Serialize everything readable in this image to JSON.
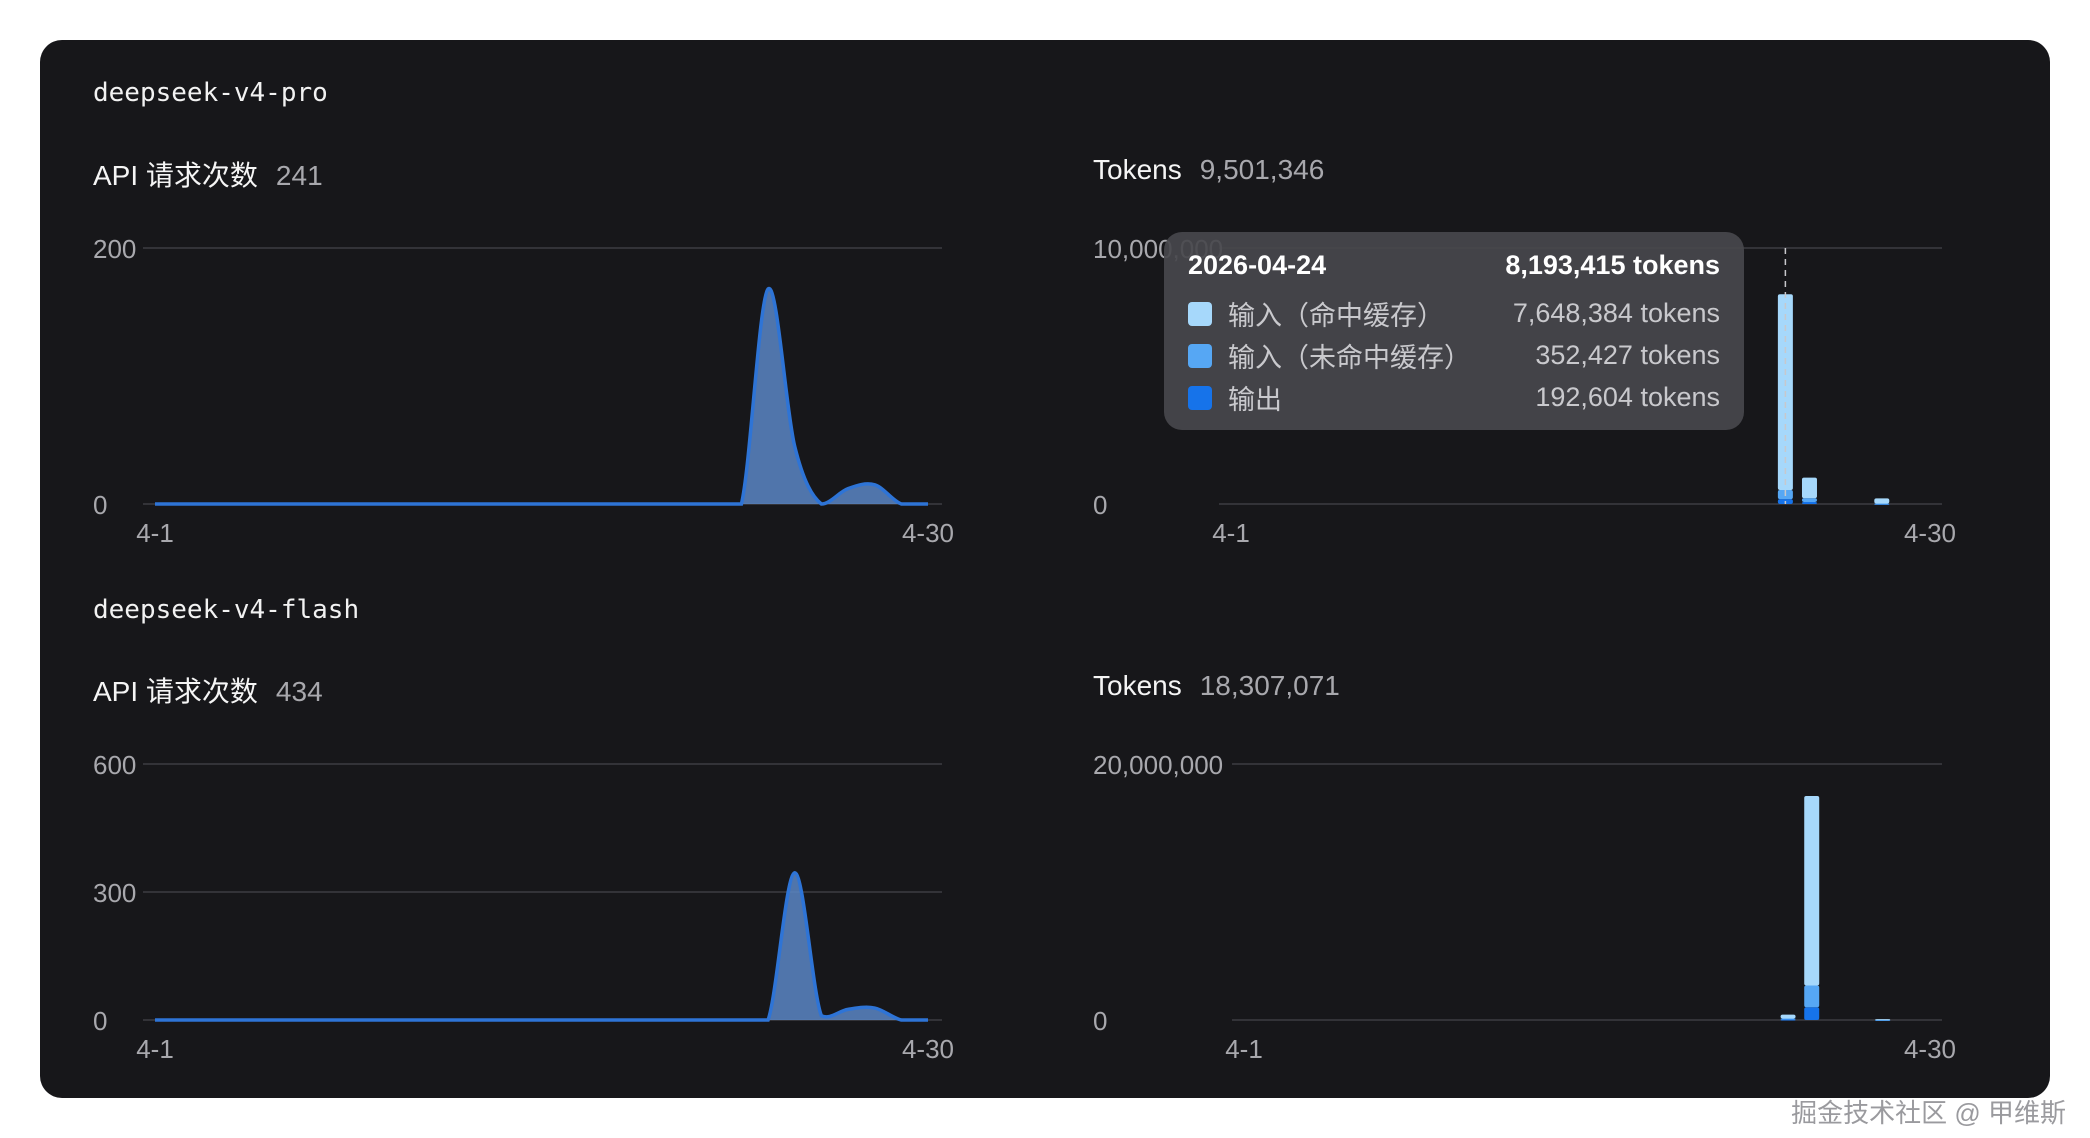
{
  "colors": {
    "area_stroke": "#2e74d6",
    "area_fill": "#5a86c6",
    "cache_hit": "#a6d8fb",
    "cache_miss": "#56a7f4",
    "output": "#1673ea",
    "grid": "#3d3d42",
    "axis_text": "#a8a8ad"
  },
  "sections": [
    {
      "model": "deepseek-v4-pro",
      "requests": {
        "label": "API 请求次数",
        "value": "241"
      },
      "tokens": {
        "label": "Tokens",
        "value": "9,501,346"
      }
    },
    {
      "model": "deepseek-v4-flash",
      "requests": {
        "label": "API 请求次数",
        "value": "434"
      },
      "tokens": {
        "label": "Tokens",
        "value": "18,307,071"
      }
    }
  ],
  "tooltip": {
    "date": "2026-04-24",
    "total": "8,193,415 tokens",
    "rows": [
      {
        "name": "输入（命中缓存）",
        "value": "7,648,384 tokens",
        "color_key": "cache_hit"
      },
      {
        "name": "输入（未命中缓存）",
        "value": "352,427 tokens",
        "color_key": "cache_miss"
      },
      {
        "name": "输出",
        "value": "192,604 tokens",
        "color_key": "output"
      }
    ]
  },
  "watermark": "掘金技术社区 @ 甲维斯",
  "chart_data": [
    {
      "id": "pro-requests",
      "type": "area",
      "x": [
        "4-1",
        "4-2",
        "4-3",
        "4-4",
        "4-5",
        "4-6",
        "4-7",
        "4-8",
        "4-9",
        "4-10",
        "4-11",
        "4-12",
        "4-13",
        "4-14",
        "4-15",
        "4-16",
        "4-17",
        "4-18",
        "4-19",
        "4-20",
        "4-21",
        "4-22",
        "4-23",
        "4-24",
        "4-25",
        "4-26",
        "4-27",
        "4-28",
        "4-29",
        "4-30"
      ],
      "values": [
        0,
        0,
        0,
        0,
        0,
        0,
        0,
        0,
        0,
        0,
        0,
        0,
        0,
        0,
        0,
        0,
        0,
        0,
        0,
        0,
        0,
        0,
        0,
        168,
        45,
        0,
        12,
        15,
        0,
        0
      ],
      "ylim": [
        0,
        200
      ],
      "yticks": [
        {
          "value": 0,
          "label": "0"
        },
        {
          "value": 200,
          "label": "200"
        }
      ],
      "xtick_labels": [
        "4-1",
        "4-30"
      ]
    },
    {
      "id": "pro-tokens",
      "type": "bar",
      "stacked": true,
      "x": [
        "4-1",
        "4-2",
        "4-3",
        "4-4",
        "4-5",
        "4-6",
        "4-7",
        "4-8",
        "4-9",
        "4-10",
        "4-11",
        "4-12",
        "4-13",
        "4-14",
        "4-15",
        "4-16",
        "4-17",
        "4-18",
        "4-19",
        "4-20",
        "4-21",
        "4-22",
        "4-23",
        "4-24",
        "4-25",
        "4-26",
        "4-27",
        "4-28",
        "4-29",
        "4-30"
      ],
      "series": [
        {
          "name": "输入（命中缓存）",
          "color_key": "cache_hit",
          "values": [
            0,
            0,
            0,
            0,
            0,
            0,
            0,
            0,
            0,
            0,
            0,
            0,
            0,
            0,
            0,
            0,
            0,
            0,
            0,
            0,
            0,
            0,
            0,
            7648384,
            800000,
            0,
            0,
            200000,
            0,
            0
          ]
        },
        {
          "name": "输入（未命中缓存）",
          "color_key": "cache_miss",
          "values": [
            0,
            0,
            0,
            0,
            0,
            0,
            0,
            0,
            0,
            0,
            0,
            0,
            0,
            0,
            0,
            0,
            0,
            0,
            0,
            0,
            0,
            0,
            0,
            352427,
            150000,
            0,
            0,
            15000,
            0,
            0
          ]
        },
        {
          "name": "输出",
          "color_key": "output",
          "values": [
            0,
            0,
            0,
            0,
            0,
            0,
            0,
            0,
            0,
            0,
            0,
            0,
            0,
            0,
            0,
            0,
            0,
            0,
            0,
            0,
            0,
            0,
            0,
            192604,
            80000,
            0,
            0,
            5000,
            0,
            0
          ]
        }
      ],
      "ylim": [
        0,
        10000000
      ],
      "yticks": [
        {
          "value": 0,
          "label": "0"
        },
        {
          "value": 10000000,
          "label": "10,000,000"
        }
      ],
      "xtick_labels": [
        "4-1",
        "4-30"
      ],
      "hover_index": 23
    },
    {
      "id": "flash-requests",
      "type": "area",
      "x": [
        "4-1",
        "4-2",
        "4-3",
        "4-4",
        "4-5",
        "4-6",
        "4-7",
        "4-8",
        "4-9",
        "4-10",
        "4-11",
        "4-12",
        "4-13",
        "4-14",
        "4-15",
        "4-16",
        "4-17",
        "4-18",
        "4-19",
        "4-20",
        "4-21",
        "4-22",
        "4-23",
        "4-24",
        "4-25",
        "4-26",
        "4-27",
        "4-28",
        "4-29",
        "4-30"
      ],
      "values": [
        0,
        0,
        0,
        0,
        0,
        0,
        0,
        0,
        0,
        0,
        0,
        0,
        0,
        0,
        0,
        0,
        0,
        0,
        0,
        0,
        0,
        0,
        0,
        0,
        345,
        10,
        25,
        28,
        0,
        0
      ],
      "ylim": [
        0,
        600
      ],
      "yticks": [
        {
          "value": 0,
          "label": "0"
        },
        {
          "value": 300,
          "label": "300"
        },
        {
          "value": 600,
          "label": "600"
        }
      ],
      "xtick_labels": [
        "4-1",
        "4-30"
      ]
    },
    {
      "id": "flash-tokens",
      "type": "bar",
      "stacked": true,
      "x": [
        "4-1",
        "4-2",
        "4-3",
        "4-4",
        "4-5",
        "4-6",
        "4-7",
        "4-8",
        "4-9",
        "4-10",
        "4-11",
        "4-12",
        "4-13",
        "4-14",
        "4-15",
        "4-16",
        "4-17",
        "4-18",
        "4-19",
        "4-20",
        "4-21",
        "4-22",
        "4-23",
        "4-24",
        "4-25",
        "4-26",
        "4-27",
        "4-28",
        "4-29",
        "4-30"
      ],
      "series": [
        {
          "name": "输入（命中缓存）",
          "color_key": "cache_hit",
          "values": [
            0,
            0,
            0,
            0,
            0,
            0,
            0,
            0,
            0,
            0,
            0,
            0,
            0,
            0,
            0,
            0,
            0,
            0,
            0,
            0,
            0,
            0,
            0,
            300000,
            14800000,
            0,
            0,
            50000,
            0,
            0
          ]
        },
        {
          "name": "输入（未命中缓存）",
          "color_key": "cache_miss",
          "values": [
            0,
            0,
            0,
            0,
            0,
            0,
            0,
            0,
            0,
            0,
            0,
            0,
            0,
            0,
            0,
            0,
            0,
            0,
            0,
            0,
            0,
            0,
            0,
            80000,
            1700000,
            0,
            0,
            10000,
            0,
            0
          ]
        },
        {
          "name": "输出",
          "color_key": "output",
          "values": [
            0,
            0,
            0,
            0,
            0,
            0,
            0,
            0,
            0,
            0,
            0,
            0,
            0,
            0,
            0,
            0,
            0,
            0,
            0,
            0,
            0,
            0,
            0,
            40000,
            1000000,
            0,
            0,
            5000,
            0,
            0
          ]
        }
      ],
      "ylim": [
        0,
        20000000
      ],
      "yticks": [
        {
          "value": 0,
          "label": "0"
        },
        {
          "value": 20000000,
          "label": "20,000,000"
        }
      ],
      "xtick_labels": [
        "4-1",
        "4-30"
      ]
    }
  ]
}
